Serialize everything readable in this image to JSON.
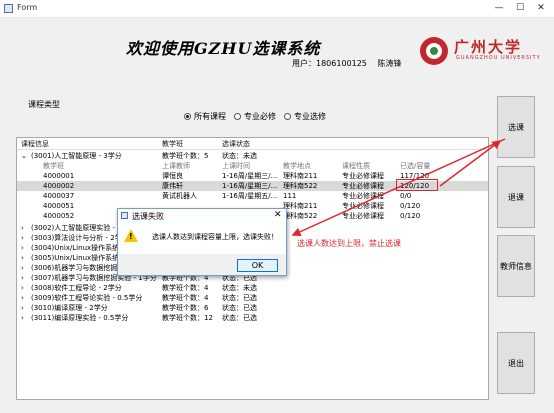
{
  "window": {
    "title": "Form",
    "controls": [
      "—",
      "☐",
      "✕"
    ]
  },
  "header": {
    "app_title": "欢迎使用GZHU选课系统",
    "user_label": "用户：1806100125",
    "user_name": "陈涛锋"
  },
  "logo": {
    "name_cn": "广州大学",
    "name_en": "GUANGZHOU UNIVERSITY",
    "colors": {
      "red": "#c0282e",
      "green": "#2f8a3a"
    }
  },
  "course_type": {
    "group_label": "课程类型",
    "options": [
      "所有课程",
      "专业必修",
      "专业选修"
    ],
    "selected": "所有课程"
  },
  "tree": {
    "header": [
      "课程信息",
      "教学班",
      "选课状态"
    ],
    "course1": {
      "label": "(3001)人工智能原理 - 3学分",
      "classes": "教学班个数：5",
      "status": "状态：未选"
    },
    "sub_header": [
      "教学班",
      "上课教师",
      "上课时间",
      "教学地点",
      "课程性质",
      "已选/容量"
    ],
    "sections": [
      [
        "4000001",
        "谭恒良",
        "1-16周/星期三/...",
        "理科南211",
        "专业必修课程",
        "117/120"
      ],
      [
        "4000002",
        "康伟轩",
        "1-16周/星期三/...",
        "理科南522",
        "专业必修课程",
        "120/120"
      ],
      [
        "4000037",
        "黄试机器人",
        "1-16周/星期五/...",
        "111",
        "专业必修课程",
        "0/0"
      ],
      [
        "4000051",
        "",
        "",
        "理科南211",
        "专业必修课程",
        "0/120"
      ],
      [
        "4000052",
        "",
        "",
        "理科南522",
        "专业必修课程",
        "0/120"
      ]
    ],
    "courses": [
      {
        "label": "(3002)人工智能原理实验 -",
        "classes": "",
        "status": ""
      },
      {
        "label": "(3003)算法设计与分析 - 2学",
        "classes": "",
        "status": ""
      },
      {
        "label": "(3004)Unix/Linux操作系统",
        "classes": "",
        "status": ""
      },
      {
        "label": "(3005)Unix/Linux操作系统",
        "classes": "",
        "status": ""
      },
      {
        "label": "(3006)机器学习与数据挖掘",
        "classes": "",
        "status": ""
      },
      {
        "label": "(3007)机器学习与数据挖掘实验 - 1学分",
        "classes": "教学班个数：4",
        "status": "状态：已选"
      },
      {
        "label": "(3008)软件工程导论 - 2学分",
        "classes": "教学班个数：4",
        "status": "状态：未选"
      },
      {
        "label": "(3009)软件工程导论实验 - 0.5学分",
        "classes": "教学班个数：4",
        "status": "状态：已选"
      },
      {
        "label": "(3010)编译原理 - 2学分",
        "classes": "教学班个数：6",
        "status": "状态：已选"
      },
      {
        "label": "(3011)编译原理实验 - 0.5学分",
        "classes": "教学班个数：12",
        "status": "状态：已选"
      }
    ]
  },
  "buttons": {
    "select": "选课",
    "withdraw": "退课",
    "info": "教师信息",
    "exit": "退出"
  },
  "dialog": {
    "title": "选课失败",
    "message": "选课人数达到课程容量上限，选课失败！",
    "ok": "OK",
    "close": "✕"
  },
  "annotation": {
    "text": "选课人数达到上限，禁止选课",
    "color": "#e0262b"
  }
}
